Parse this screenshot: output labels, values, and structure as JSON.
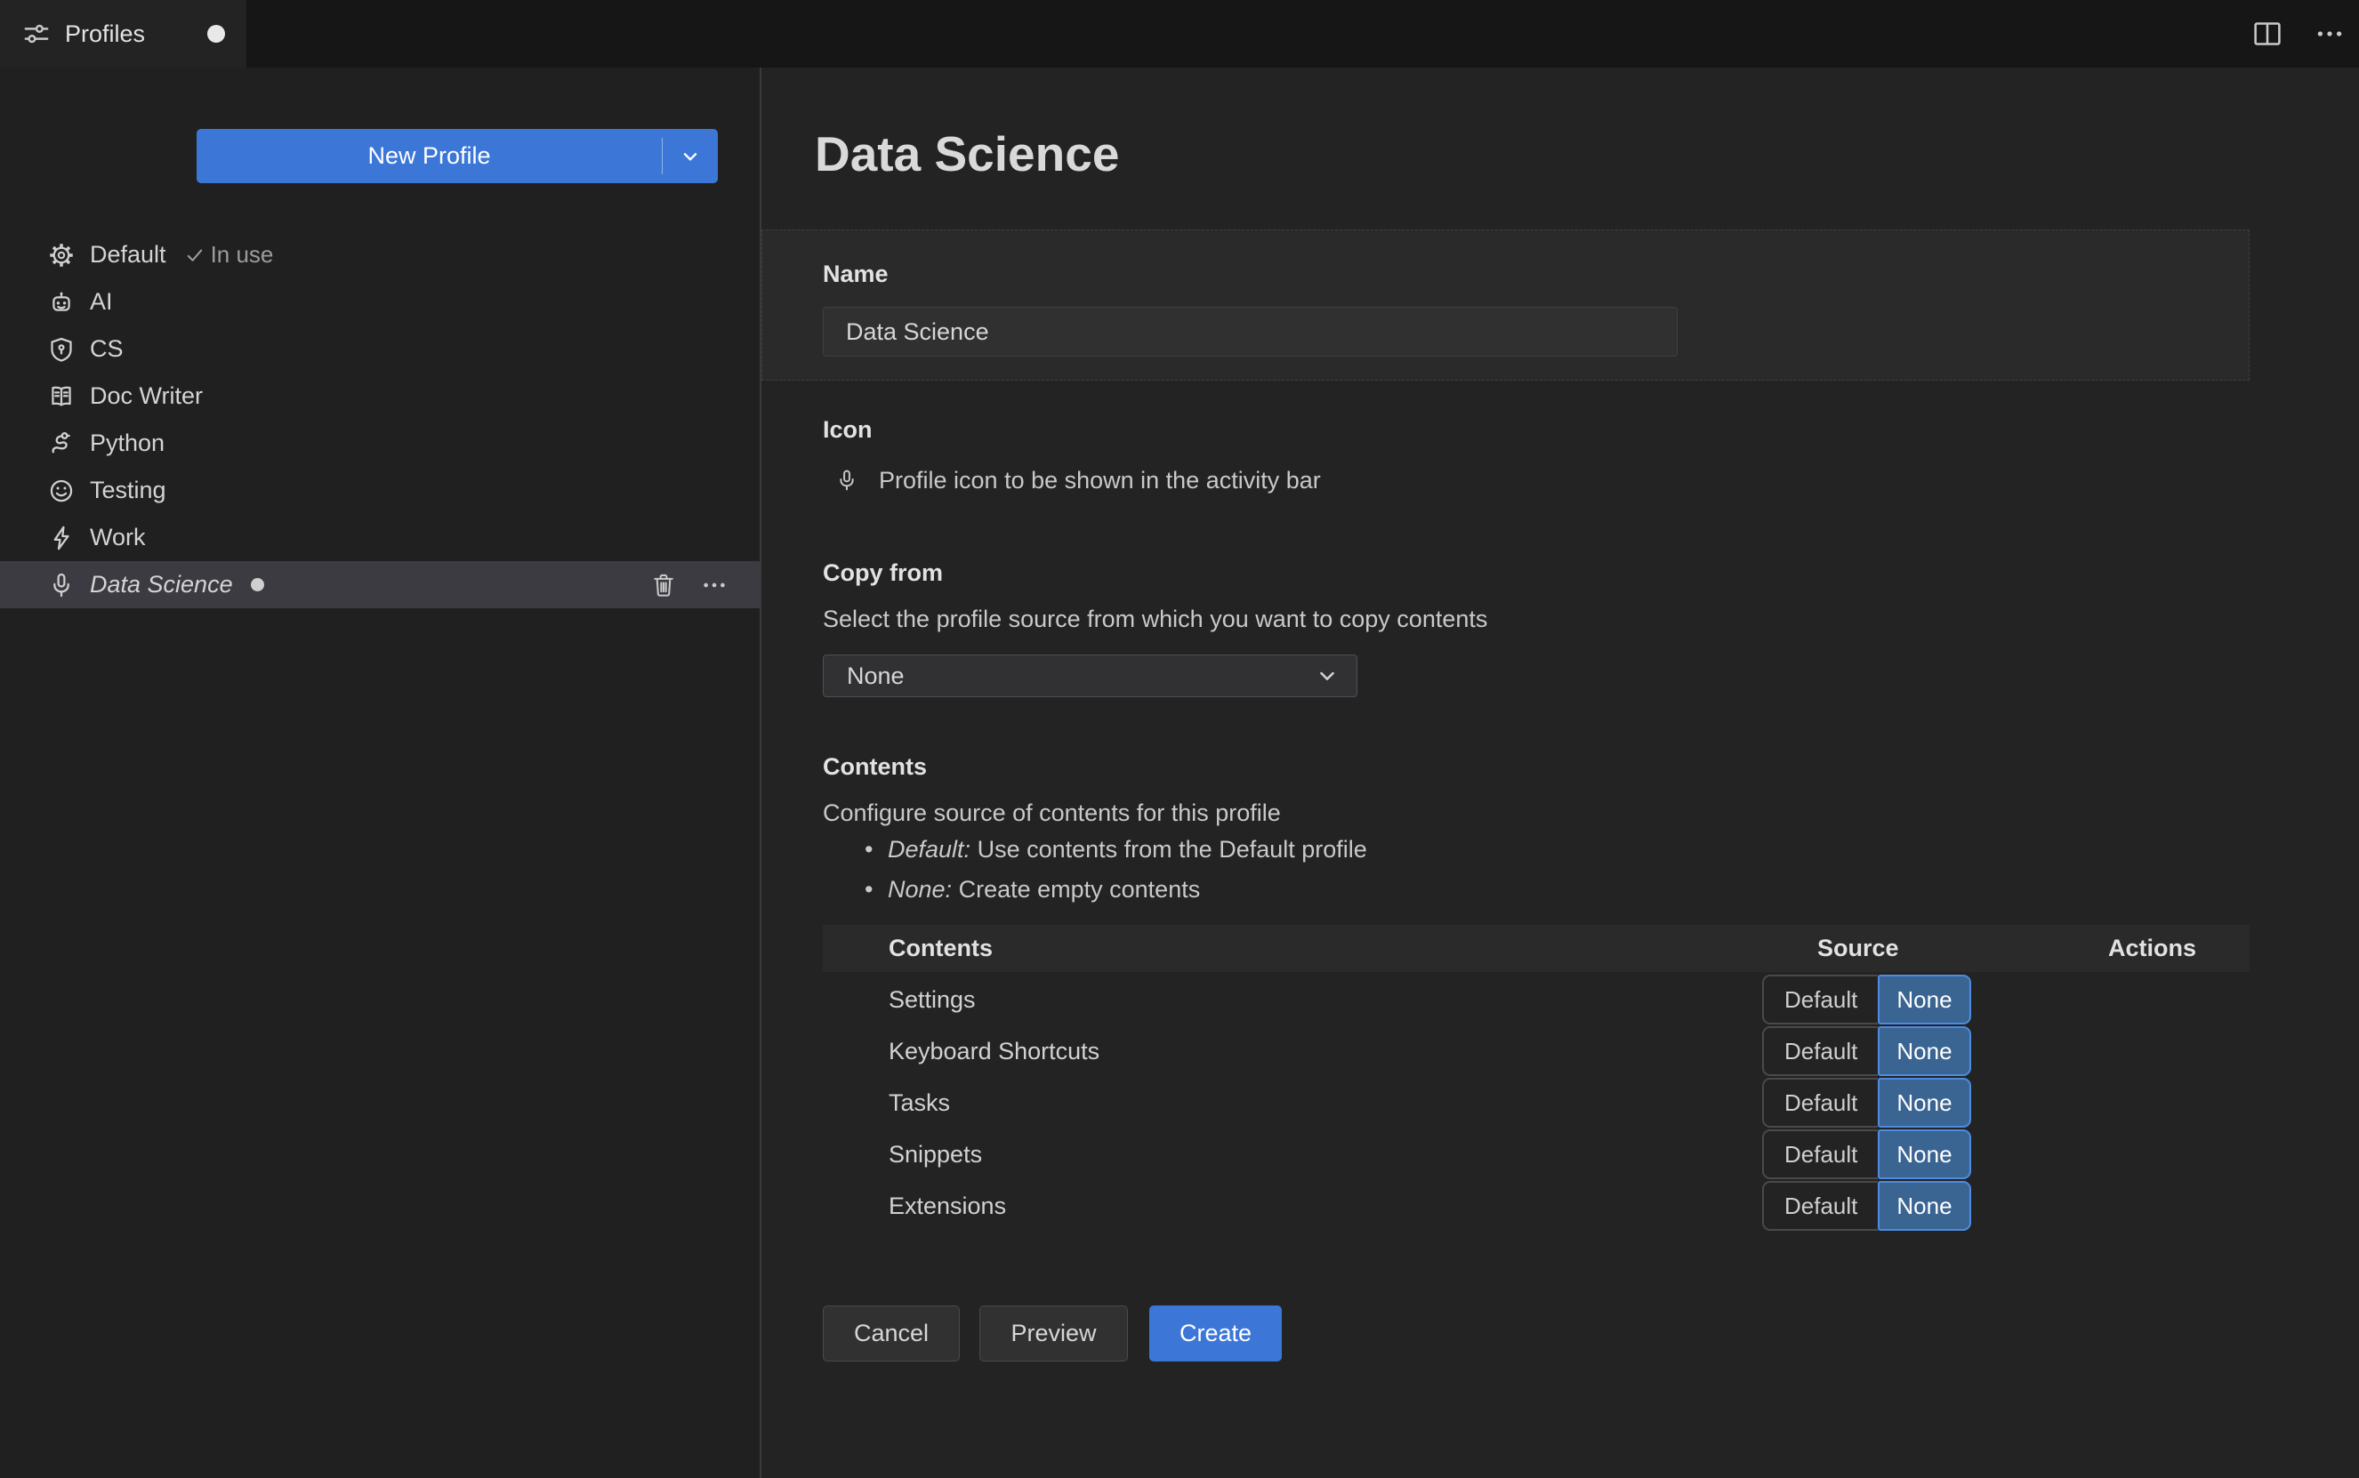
{
  "tab": {
    "title": "Profiles",
    "modified": true
  },
  "sidebar": {
    "new_profile_label": "New Profile",
    "profiles": [
      {
        "name": "Default",
        "icon": "gear-icon",
        "badge": "In use"
      },
      {
        "name": "AI",
        "icon": "robot-icon"
      },
      {
        "name": "CS",
        "icon": "shield-icon"
      },
      {
        "name": "Doc Writer",
        "icon": "book-icon"
      },
      {
        "name": "Python",
        "icon": "snake-icon"
      },
      {
        "name": "Testing",
        "icon": "smiley-icon"
      },
      {
        "name": "Work",
        "icon": "lightning-icon"
      },
      {
        "name": "Data Science",
        "icon": "microphone-icon",
        "selected": true,
        "modified": true
      }
    ]
  },
  "editor": {
    "title": "Data Science",
    "name_section": {
      "label": "Name",
      "value": "Data Science"
    },
    "icon_section": {
      "label": "Icon",
      "icon": "microphone-icon",
      "description": "Profile icon to be shown in the activity bar"
    },
    "copy_from": {
      "label": "Copy from",
      "description": "Select the profile source from which you want to copy contents",
      "value": "None"
    },
    "contents_section": {
      "label": "Contents",
      "description": "Configure source of contents for this profile",
      "bullets": [
        {
          "term": "Default:",
          "text": "Use contents from the Default profile"
        },
        {
          "term": "None:",
          "text": "Create empty contents"
        }
      ],
      "table": {
        "headers": [
          "Contents",
          "Source",
          "Actions"
        ],
        "source_options": [
          "Default",
          "None"
        ],
        "rows": [
          {
            "label": "Settings",
            "source": "None"
          },
          {
            "label": "Keyboard Shortcuts",
            "source": "None"
          },
          {
            "label": "Tasks",
            "source": "None"
          },
          {
            "label": "Snippets",
            "source": "None"
          },
          {
            "label": "Extensions",
            "source": "None"
          }
        ]
      }
    },
    "footer": {
      "cancel": "Cancel",
      "preview": "Preview",
      "create": "Create"
    }
  },
  "colors": {
    "accent_blue": "#3c77d8",
    "toggle_selected_bg": "#3a6593",
    "toggle_selected_border": "#4f8be0",
    "selected_row_bg": "#3b3b41",
    "base_bg": "#232323",
    "tab_strip_bg": "#161616"
  }
}
